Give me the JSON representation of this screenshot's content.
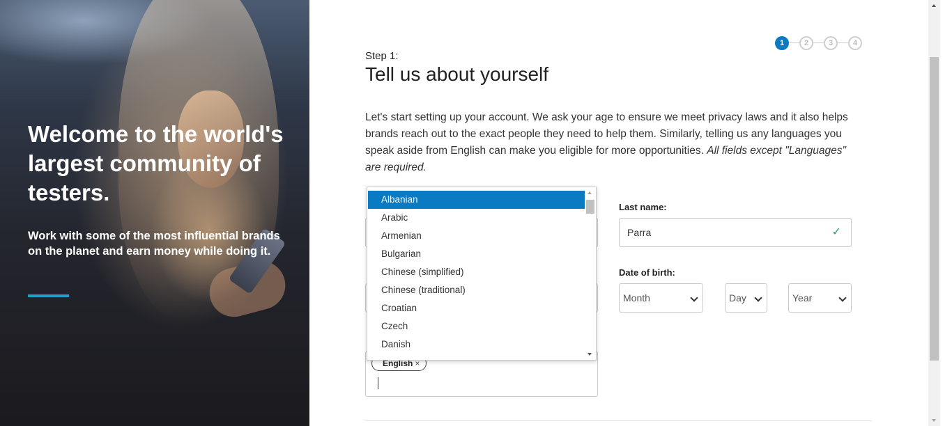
{
  "hero": {
    "title": "Welcome to the world's largest community of testers.",
    "subtitle": "Work with some of the most influential brands on the planet and earn money while doing it."
  },
  "steps": [
    "1",
    "2",
    "3",
    "4"
  ],
  "current_step": 1,
  "form": {
    "step_label": "Step 1:",
    "title": "Tell us about yourself",
    "intro": "Let's start setting up your account. We ask your age to ensure we meet privacy laws and it also helps brands reach out to the exact people they need to help them. Similarly, telling us any languages you speak aside from English can make you eligible for more opportunities.",
    "intro_note": "All fields except \"Languages\" are required.",
    "last_name_label": "Last name:",
    "last_name_value": "Parra",
    "dob_label": "Date of birth:",
    "month_value": "Month",
    "day_value": "Day",
    "year_value": "Year",
    "language_chip": "English",
    "language_chip_remove": "×"
  },
  "language_options": [
    "Albanian",
    "Arabic",
    "Armenian",
    "Bulgarian",
    "Chinese (simplified)",
    "Chinese (traditional)",
    "Croatian",
    "Czech",
    "Danish"
  ],
  "selected_language": "Albanian",
  "colors": {
    "accent": "#0a7bc2",
    "hero_rule": "#1fa0c9",
    "valid": "#2e9e4f"
  },
  "icons": {
    "valid": "check-icon",
    "select": "chevron-down-icon",
    "remove": "close-icon"
  }
}
